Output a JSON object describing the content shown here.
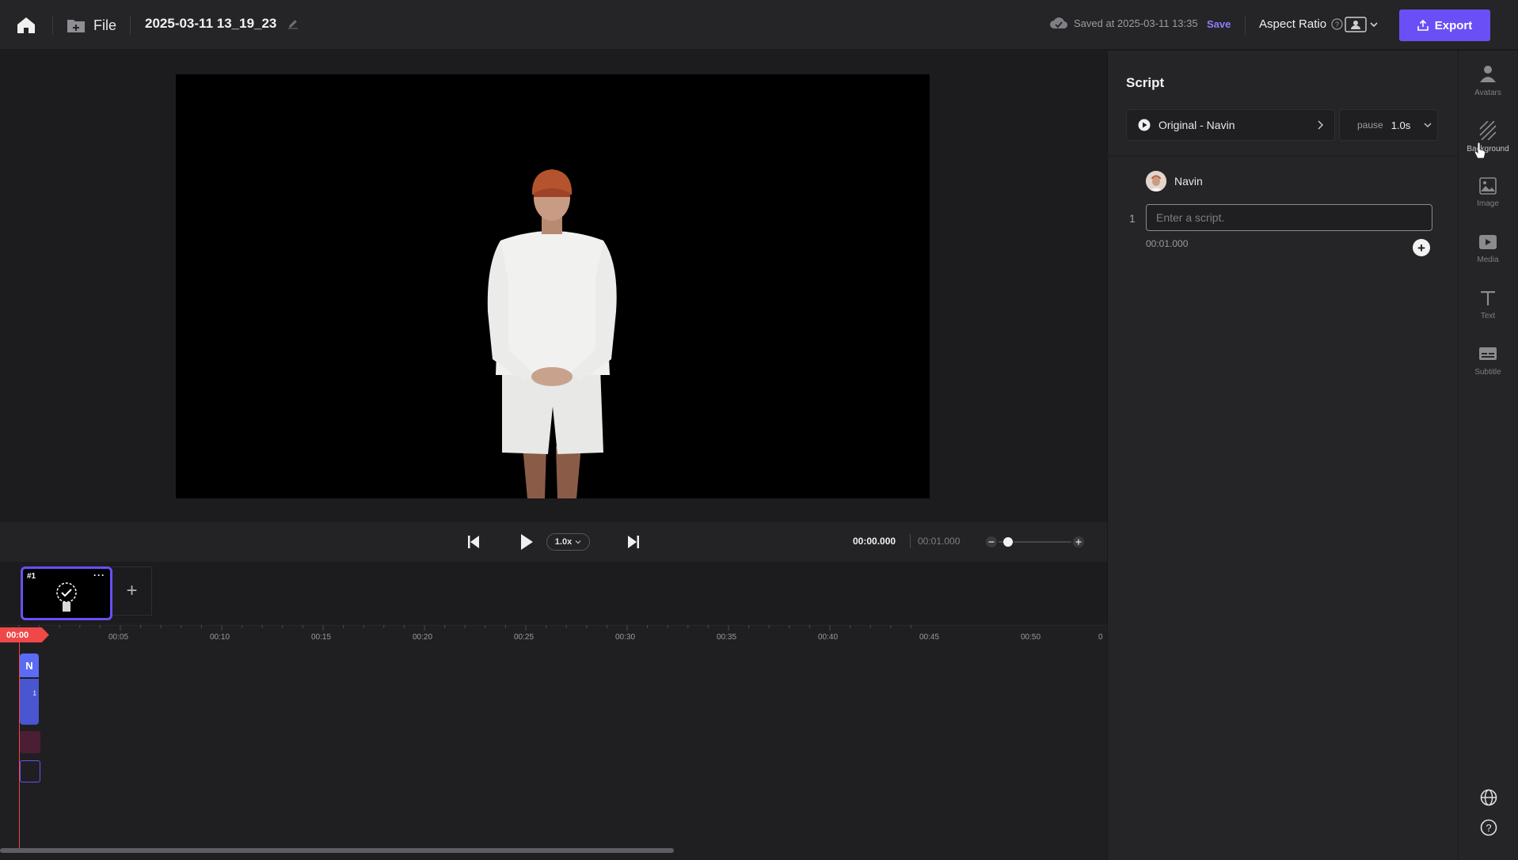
{
  "header": {
    "file_label": "File",
    "project_title": "2025-03-11 13_19_23",
    "saved_text": "Saved at 2025-03-11 13:35",
    "save_label": "Save",
    "aspect_ratio_label": "Aspect Ratio",
    "export_label": "Export"
  },
  "playback": {
    "speed": "1.0x",
    "current_time": "00:00.000",
    "total_time": "00:01.000"
  },
  "scenes": [
    {
      "number": "#1",
      "more": "···"
    }
  ],
  "timeline": {
    "playhead": "00:00",
    "ruler": [
      "00:05",
      "00:10",
      "00:15",
      "00:20",
      "00:25",
      "00:30",
      "00:35",
      "00:40",
      "00:45",
      "00:50",
      "0"
    ],
    "tracks": {
      "avatar_label": "N",
      "script_label": "1"
    }
  },
  "script": {
    "title": "Script",
    "voice": "Original - Navin",
    "pause_label": "pause",
    "pause_value": "1.0s",
    "speaker": "Navin",
    "lines": [
      {
        "number": "1",
        "placeholder": "Enter a script.",
        "value": "",
        "duration": "00:01.000"
      }
    ]
  },
  "rail": {
    "items": [
      {
        "label": "Avatars",
        "icon": "person-icon"
      },
      {
        "label": "Background",
        "icon": "hatch-icon"
      },
      {
        "label": "Image",
        "icon": "image-icon"
      },
      {
        "label": "Media",
        "icon": "play-box-icon"
      },
      {
        "label": "Text",
        "icon": "text-icon"
      },
      {
        "label": "Subtitle",
        "icon": "subtitle-icon"
      }
    ]
  },
  "colors": {
    "accent": "#6b4ff6",
    "save_link": "#8b7dff",
    "playhead": "#f04848"
  }
}
